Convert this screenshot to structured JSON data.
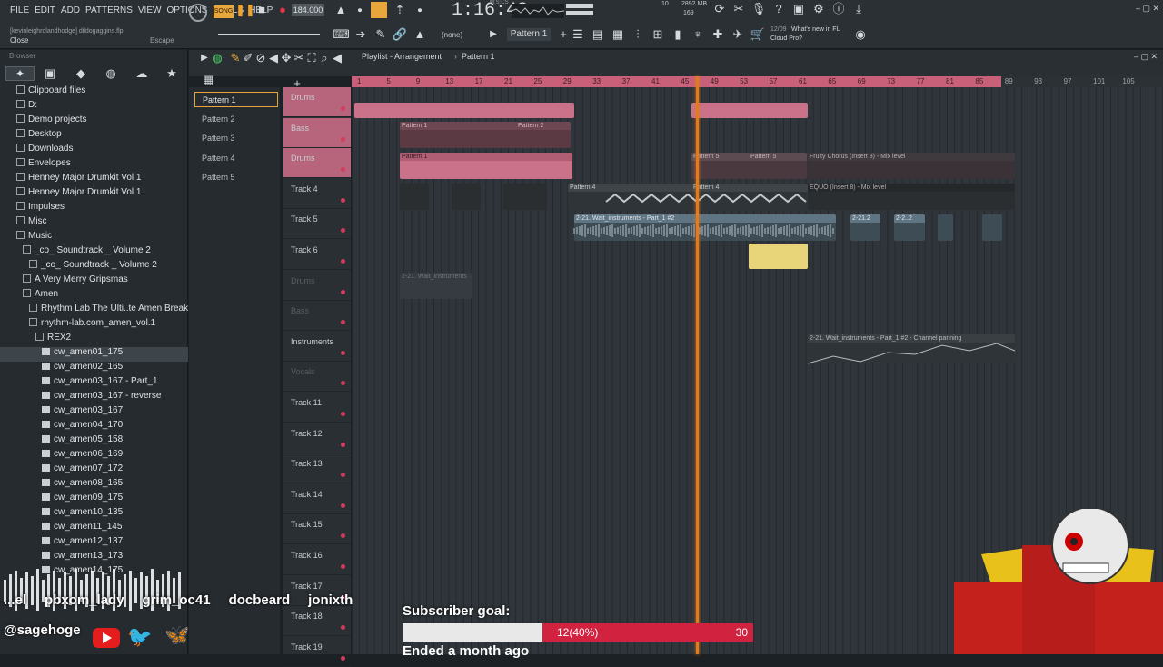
{
  "menu": [
    "FILE",
    "EDIT",
    "ADD",
    "PATTERNS",
    "VIEW",
    "OPTIONS",
    "TOOLS",
    "HELP"
  ],
  "hint": {
    "user": "[kevinleighrolandhodge] dildogaggins.flp",
    "close": "Close",
    "escape": "Escape"
  },
  "transport": {
    "mode": "SONG",
    "tempo": "184.000",
    "time": "1:16:48",
    "time_label": "M:S:CS",
    "mem": "2892 MB",
    "cpu_a": "10",
    "cpu_b": "169"
  },
  "toolbar2": {
    "snap": "(none)",
    "pattern": "Pattern 1",
    "news_date": "12/09",
    "news_title": "What's new in FL",
    "news_sub": "Cloud Pro?"
  },
  "browser": {
    "title": "Browser",
    "items": [
      {
        "label": "Clipboard files",
        "type": "folder",
        "indent": 0
      },
      {
        "label": "D:",
        "type": "folder",
        "indent": 0
      },
      {
        "label": "Demo projects",
        "type": "folder",
        "indent": 0
      },
      {
        "label": "Desktop",
        "type": "folder",
        "indent": 0
      },
      {
        "label": "Downloads",
        "type": "folder",
        "indent": 0
      },
      {
        "label": "Envelopes",
        "type": "folder",
        "indent": 0
      },
      {
        "label": "Henney Major Drumkit Vol 1",
        "type": "folder",
        "indent": 0
      },
      {
        "label": "Henney Major Drumkit Vol 1",
        "type": "folder",
        "indent": 0
      },
      {
        "label": "Impulses",
        "type": "folder",
        "indent": 0
      },
      {
        "label": "Misc",
        "type": "folder",
        "indent": 0
      },
      {
        "label": "Music",
        "type": "folder",
        "indent": 0
      },
      {
        "label": "_co_ Soundtrack _ Volume 2",
        "type": "folder",
        "indent": 1
      },
      {
        "label": "_co_ Soundtrack _ Volume 2",
        "type": "folder",
        "indent": 2
      },
      {
        "label": "A Very Merry Gripsmas",
        "type": "folder",
        "indent": 1
      },
      {
        "label": "Amen",
        "type": "folder",
        "indent": 1
      },
      {
        "label": "Rhythm Lab The Ulti..te Amen Breaks Pack",
        "type": "folder",
        "indent": 2
      },
      {
        "label": "rhythm-lab.com_amen_vol.1",
        "type": "folder",
        "indent": 2
      },
      {
        "label": "REX2",
        "type": "folder",
        "indent": 3
      },
      {
        "label": "cw_amen01_175",
        "type": "file",
        "indent": 4
      },
      {
        "label": "cw_amen02_165",
        "type": "file",
        "indent": 4
      },
      {
        "label": "cw_amen03_167 - Part_1",
        "type": "file",
        "indent": 4
      },
      {
        "label": "cw_amen03_167 - reverse",
        "type": "file",
        "indent": 4
      },
      {
        "label": "cw_amen03_167",
        "type": "file",
        "indent": 4
      },
      {
        "label": "cw_amen04_170",
        "type": "file",
        "indent": 4
      },
      {
        "label": "cw_amen05_158",
        "type": "file",
        "indent": 4
      },
      {
        "label": "cw_amen06_169",
        "type": "file",
        "indent": 4
      },
      {
        "label": "cw_amen07_172",
        "type": "file",
        "indent": 4
      },
      {
        "label": "cw_amen08_165",
        "type": "file",
        "indent": 4
      },
      {
        "label": "cw_amen09_175",
        "type": "file",
        "indent": 4
      },
      {
        "label": "cw_amen10_135",
        "type": "file",
        "indent": 4
      },
      {
        "label": "cw_amen11_145",
        "type": "file",
        "indent": 4
      },
      {
        "label": "cw_amen12_137",
        "type": "file",
        "indent": 4
      },
      {
        "label": "cw_amen13_173",
        "type": "file",
        "indent": 4
      },
      {
        "label": "cw_amen14_175",
        "type": "file",
        "indent": 4
      }
    ]
  },
  "playlist": {
    "title": "Playlist - Arrangement",
    "crumb": "Pattern 1"
  },
  "patterns": [
    "Pattern 1",
    "Pattern 2",
    "Pattern 3",
    "Pattern 4",
    "Pattern 5"
  ],
  "tracks": [
    "Drums",
    "Bass",
    "Drums",
    "Track 4",
    "Track 5",
    "Track 6",
    "Drums",
    "Bass",
    "Instruments",
    "Vocals",
    "Track 11",
    "Track 12",
    "Track 13",
    "Track 14",
    "Track 15",
    "Track 16",
    "Track 17",
    "Track 18",
    "Track 19"
  ],
  "ruler": [
    "1",
    "5",
    "9",
    "13",
    "17",
    "21",
    "25",
    "29",
    "33",
    "37",
    "41",
    "45",
    "49",
    "53",
    "57",
    "61",
    "65",
    "69",
    "73",
    "77",
    "81",
    "85",
    "89",
    "93",
    "97",
    "101",
    "105"
  ],
  "clips": {
    "pattern1": "Pattern 1",
    "pattern2": "Pattern 2",
    "pattern4": "Pattern 4",
    "pattern5": "Pattern 5",
    "chorus": "Fruity Chorus (Insert 8) - Mix level",
    "eq": "EQUO (Insert 8) - Mix level",
    "audio": "2-21. Wait_instruments - Part_1 #2",
    "audio_short": "2-21.2",
    "audio_short2": "2-2..2",
    "muted": "2-21. Wait_instruments",
    "pan": "2-21. Wait_instruments - Part_1 #2 - Channel panning"
  },
  "overlay": {
    "chatters": [
      "...el",
      "pbxom_lady",
      "grim_oc41",
      "docbeard",
      "jonixth"
    ],
    "handle": "@sagehoge",
    "goal_title": "Subscriber goal:",
    "goal_current": "12(40%)",
    "goal_target": "30",
    "goal_percent": 40,
    "goal_footer": "Ended a month ago"
  },
  "colors": {
    "accent": "#e27b1d",
    "clip_pink": "#c8607a",
    "goal_red": "#d1223f"
  }
}
